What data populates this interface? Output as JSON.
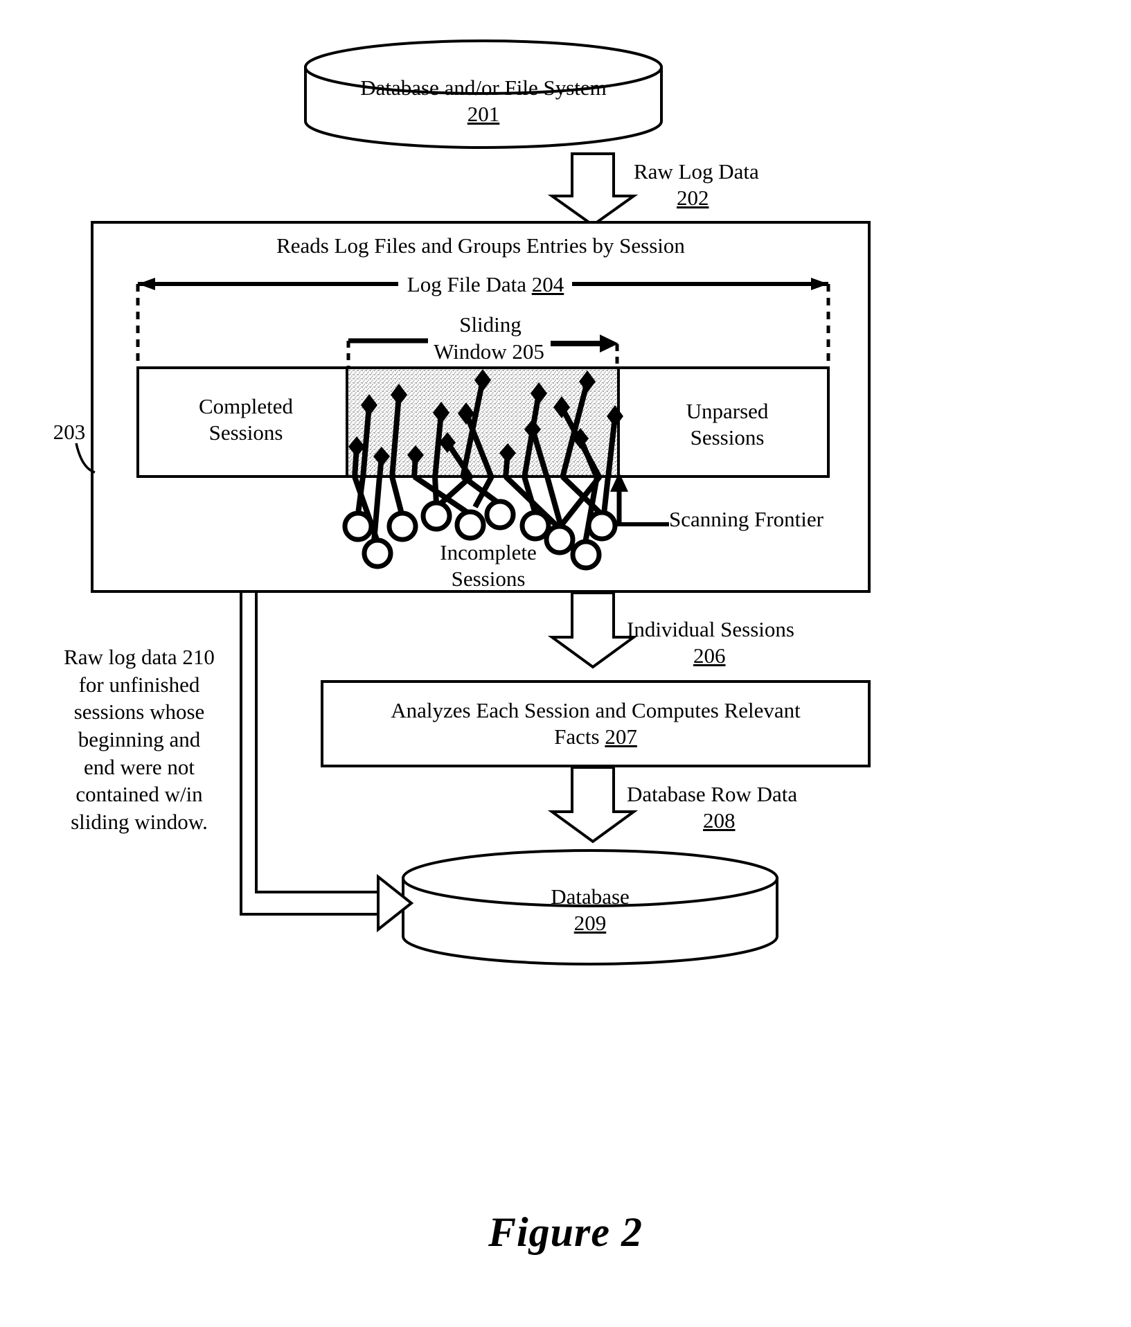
{
  "figure": {
    "caption": "Figure 2"
  },
  "nodes": {
    "source_db": {
      "label": "Database and/or File System",
      "ref": "201"
    },
    "reader_box": {
      "label": "Reads Log Files and Groups Entries by Session",
      "ref": "203"
    },
    "log_file_data": {
      "label": "Log File Data",
      "ref": "204"
    },
    "sliding_window": {
      "label_line1": "Sliding",
      "label_line2": "Window",
      "ref": "205"
    },
    "completed": {
      "line1": "Completed",
      "line2": "Sessions"
    },
    "unparsed": {
      "line1": "Unparsed",
      "line2": "Sessions"
    },
    "incomplete": {
      "line1": "Incomplete",
      "line2": "Sessions"
    },
    "scanning_frontier": {
      "label": "Scanning Frontier"
    },
    "analyzer_box": {
      "line1": "Analyzes Each Session and Computes Relevant",
      "line2": "Facts",
      "ref": "207"
    },
    "target_db": {
      "label": "Database",
      "ref": "209"
    }
  },
  "flows": {
    "raw_log_data": {
      "label": "Raw Log Data",
      "ref": "202"
    },
    "individual_sessions": {
      "label": "Individual Sessions",
      "ref": "206"
    },
    "database_row_data": {
      "label": "Database Row Data",
      "ref": "208"
    },
    "feedback_note": {
      "line1": "Raw log data  210",
      "line2": "for unfinished",
      "line3": "sessions whose",
      "line4": "beginning and",
      "line5": "end were not",
      "line6": "contained w/in",
      "line7": "sliding window."
    }
  },
  "colors": {
    "stroke": "#000000",
    "fill": "#ffffff",
    "window_shade": "#c9c9c9"
  }
}
